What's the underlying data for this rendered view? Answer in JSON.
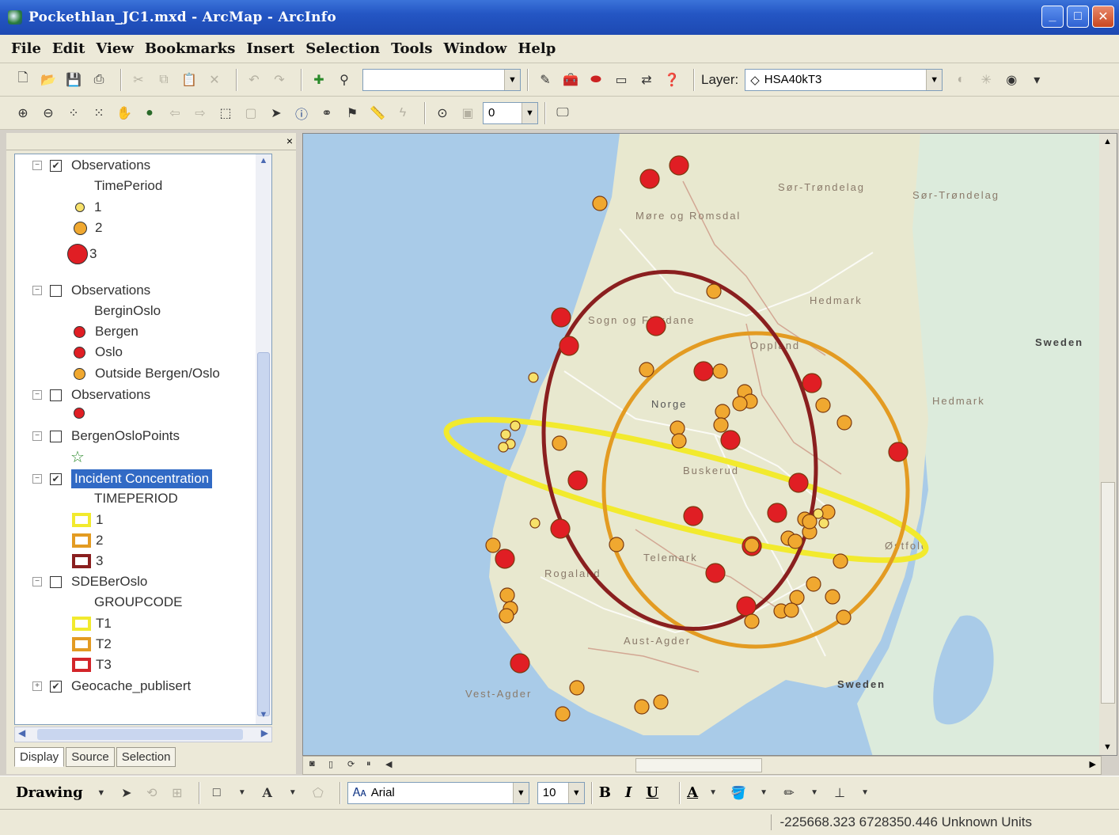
{
  "window": {
    "title": "Pockethlan_JC1.mxd - ArcMap - ArcInfo",
    "controls": {
      "minimize": "_",
      "maximize": "□",
      "close": "✕"
    }
  },
  "menu": [
    "File",
    "Edit",
    "View",
    "Bookmarks",
    "Insert",
    "Selection",
    "Tools",
    "Window",
    "Help"
  ],
  "toolbar": {
    "layer_label": "Layer:",
    "layer_value": "HSA40kT3",
    "scale_value": "",
    "zoom_value": "0"
  },
  "toc": {
    "close": "×",
    "layers": [
      {
        "name": "Observations",
        "checked": true,
        "field": "TimePeriod",
        "classes": [
          {
            "label": "1"
          },
          {
            "label": "2"
          },
          {
            "label": "3"
          }
        ]
      },
      {
        "name": "Observations",
        "checked": false,
        "field": "BerginOslo",
        "classes": [
          {
            "label": "Bergen"
          },
          {
            "label": "Oslo"
          },
          {
            "label": "Outside Bergen/Oslo"
          }
        ]
      },
      {
        "name": "Observations",
        "checked": false
      },
      {
        "name": "BergenOsloPoints",
        "checked": false
      },
      {
        "name": "Incident Concentration",
        "checked": true,
        "field": "TIMEPERIOD",
        "classes": [
          {
            "label": "1"
          },
          {
            "label": "2"
          },
          {
            "label": "3"
          }
        ]
      },
      {
        "name": "SDEBerOslo",
        "checked": false,
        "field": "GROUPCODE",
        "classes": [
          {
            "label": "T1"
          },
          {
            "label": "T2"
          },
          {
            "label": "T3"
          }
        ]
      },
      {
        "name": "Geocache_publisert",
        "checked": true
      }
    ],
    "tabs": [
      "Display",
      "Source",
      "Selection"
    ]
  },
  "map": {
    "labels": {
      "sor_trondelag_1": "Sør-Trøndelag",
      "sor_trondelag_2": "Sør-Trøndelag",
      "more_romsdal": "Møre og Romsdal",
      "hedmark_1": "Hedmark",
      "hedmark_2": "Hedmark",
      "sweden_1": "Sweden",
      "sweden_2": "Sweden",
      "oppland": "Oppland",
      "buskerud": "Buskerud",
      "telemark": "Telemark",
      "aust_agder": "Aust-Agder",
      "vest_agder": "Vest-Agder",
      "ostfold": "Østfold",
      "rogaland": "Rogaland",
      "sogn_fjordane": "Sogn og Fjordane",
      "norge": "Norge"
    },
    "colors": {
      "sea": "#a9cbe8",
      "land": "#e6ead4",
      "period1": "#f2ea2e",
      "period2": "#e39b22",
      "period3": "#8a1f1f",
      "red_point": "#e01e24",
      "orange_point": "#f0a830"
    }
  },
  "drawing": {
    "label": "Drawing",
    "font": "Arial",
    "size": "10",
    "bold": "B",
    "italic": "I",
    "underline": "U",
    "fontcolor": "A"
  },
  "status": {
    "coords": "-225668.323 6728350.446 Unknown Units"
  }
}
